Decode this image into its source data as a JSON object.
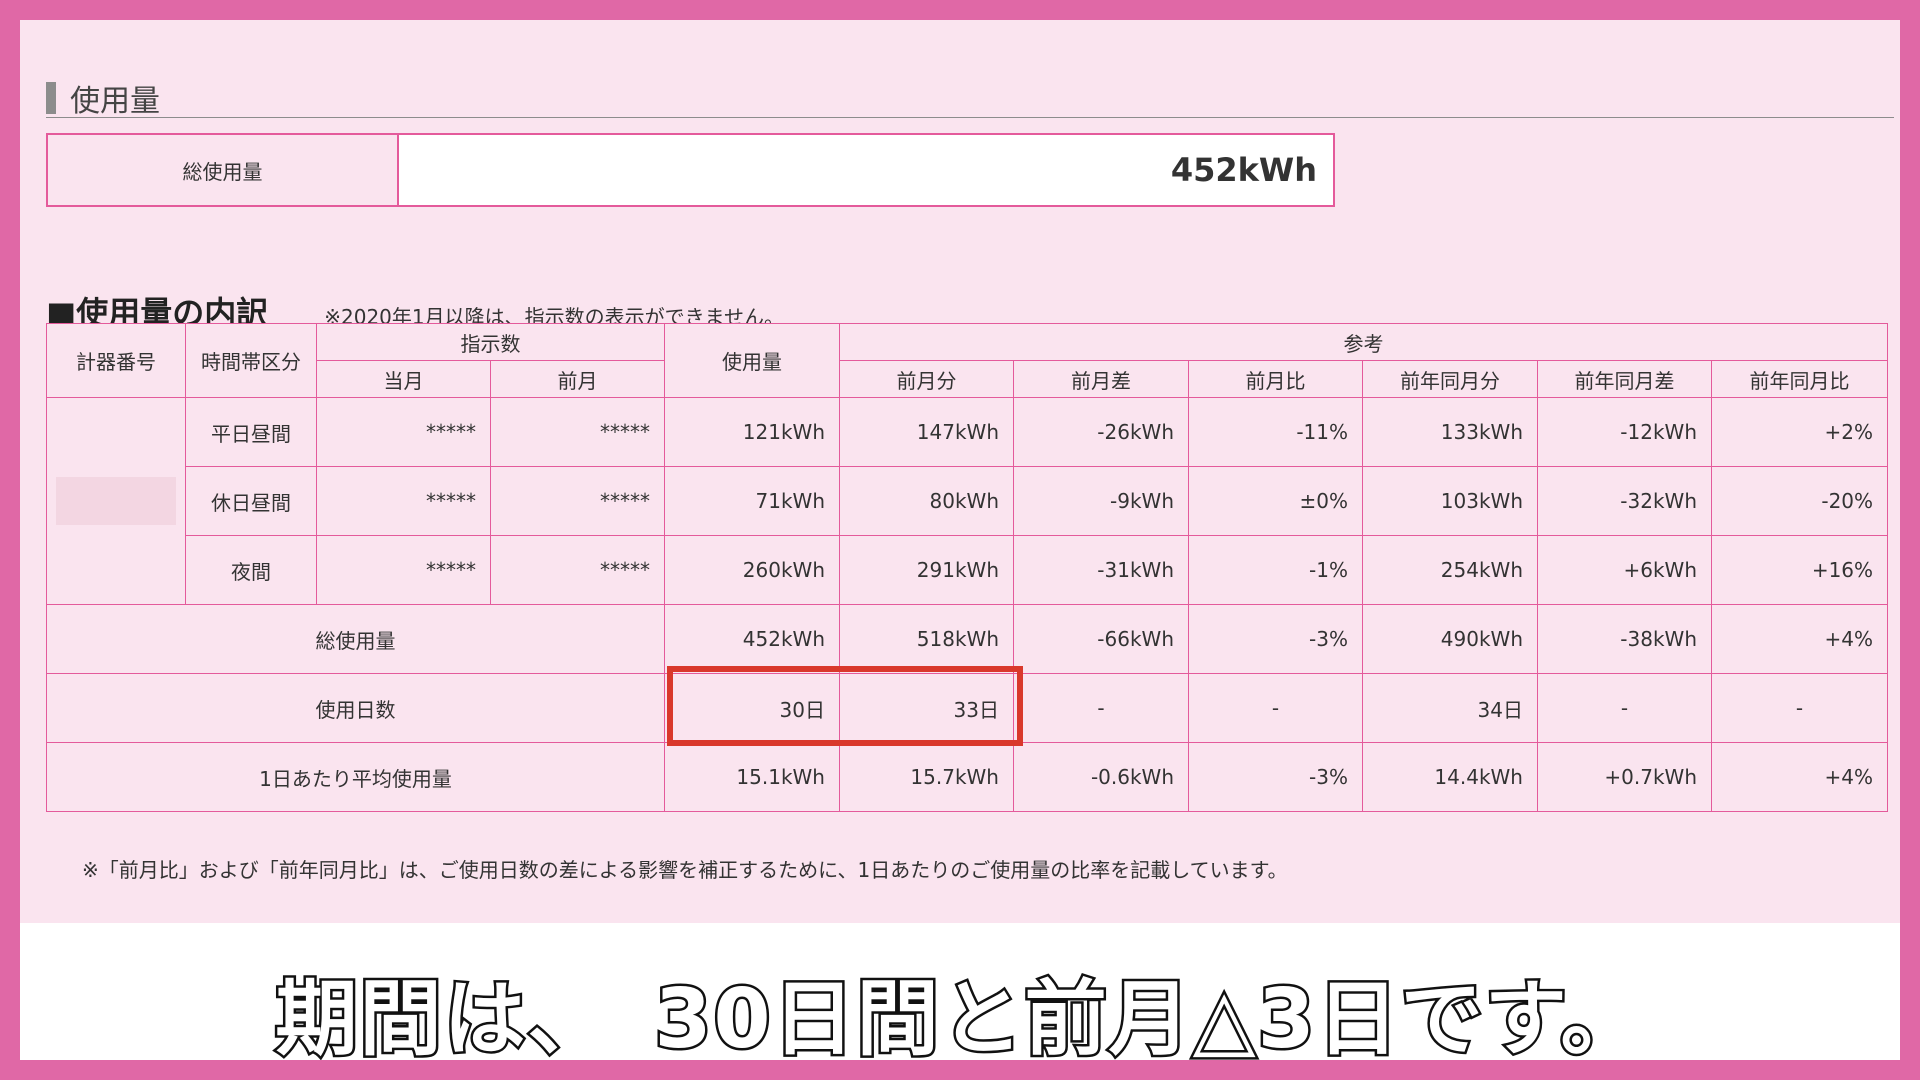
{
  "section_title": "使用量",
  "total_label": "総使用量",
  "total_value": "452kWh",
  "breakdown_title": "■使用量の内訳",
  "breakdown_note": "※2020年1月以降は、指示数の表示ができません。",
  "headers": {
    "meter": "計器番号",
    "timeband": "時間帯区分",
    "reading": "指示数",
    "reading_current": "当月",
    "reading_prev": "前月",
    "usage": "使用量",
    "reference": "参考",
    "prev_month": "前月分",
    "prev_diff": "前月差",
    "prev_ratio": "前月比",
    "prev_year": "前年同月分",
    "prev_year_diff": "前年同月差",
    "prev_year_ratio": "前年同月比"
  },
  "rows": [
    {
      "band": "平日昼間",
      "cur": "*****",
      "prev": "*****",
      "usage": "121kWh",
      "pm": "147kWh",
      "pmd": "-26kWh",
      "pmr": "-11%",
      "py": "133kWh",
      "pyd": "-12kWh",
      "pyr": "+2%"
    },
    {
      "band": "休日昼間",
      "cur": "*****",
      "prev": "*****",
      "usage": "71kWh",
      "pm": "80kWh",
      "pmd": "-9kWh",
      "pmr": "±0%",
      "py": "103kWh",
      "pyd": "-32kWh",
      "pyr": "-20%"
    },
    {
      "band": "夜間",
      "cur": "*****",
      "prev": "*****",
      "usage": "260kWh",
      "pm": "291kWh",
      "pmd": "-31kWh",
      "pmr": "-1%",
      "py": "254kWh",
      "pyd": "+6kWh",
      "pyr": "+16%"
    }
  ],
  "summary_rows": [
    {
      "label": "総使用量",
      "usage": "452kWh",
      "pm": "518kWh",
      "pmd": "-66kWh",
      "pmr": "-3%",
      "py": "490kWh",
      "pyd": "-38kWh",
      "pyr": "+4%"
    },
    {
      "label": "使用日数",
      "usage": "30日",
      "pm": "33日",
      "pmd": "-",
      "pmr": "-",
      "py": "34日",
      "pyd": "-",
      "pyr": "-"
    },
    {
      "label": "1日あたり平均使用量",
      "usage": "15.1kWh",
      "pm": "15.7kWh",
      "pmd": "-0.6kWh",
      "pmr": "-3%",
      "py": "14.4kWh",
      "pyd": "+0.7kWh",
      "pyr": "+4%"
    }
  ],
  "footnote": "※「前月比」および「前年同月比」は、ご使用日数の差による影響を補正するために、1日あたりのご使用量の比率を記載しています。",
  "caption": "期間は、　30日間と前月△3日です。",
  "colors": {
    "frame": "#e068a6",
    "border": "#e45a9b",
    "panel": "#fae4ef",
    "highlight": "#d9382b"
  }
}
